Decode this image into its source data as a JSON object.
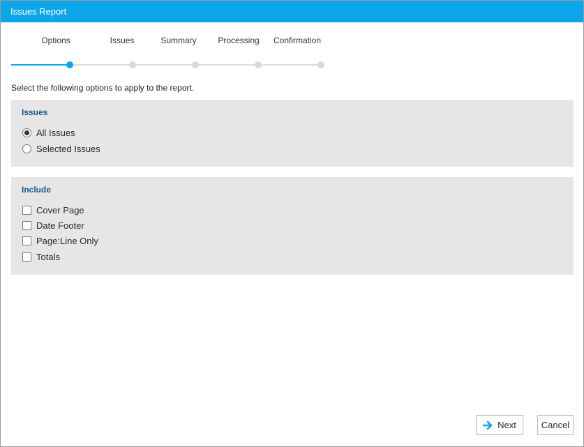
{
  "window": {
    "title": "Issues Report"
  },
  "steps": [
    {
      "label": "Options",
      "active": true
    },
    {
      "label": "Issues",
      "active": false
    },
    {
      "label": "Summary",
      "active": false
    },
    {
      "label": "Processing",
      "active": false
    },
    {
      "label": "Confirmation",
      "active": false
    }
  ],
  "progress": {
    "current_step": 1,
    "total_steps": 5
  },
  "instruction": "Select the following options to apply to the report.",
  "issues_panel": {
    "title": "Issues",
    "options": [
      {
        "label": "All Issues",
        "selected": true
      },
      {
        "label": "Selected Issues",
        "selected": false
      }
    ]
  },
  "include_panel": {
    "title": "Include",
    "options": [
      {
        "label": "Cover Page",
        "checked": false
      },
      {
        "label": "Date Footer",
        "checked": false
      },
      {
        "label": "Page:Line Only",
        "checked": false
      },
      {
        "label": "Totals",
        "checked": false
      }
    ]
  },
  "buttons": {
    "next_label": "Next",
    "cancel_label": "Cancel",
    "next_icon": "arrow-right-icon"
  },
  "colors": {
    "accent": "#0ba6ea",
    "panel_bg": "#e6e6e6",
    "panel_title": "#1b5a8a"
  }
}
